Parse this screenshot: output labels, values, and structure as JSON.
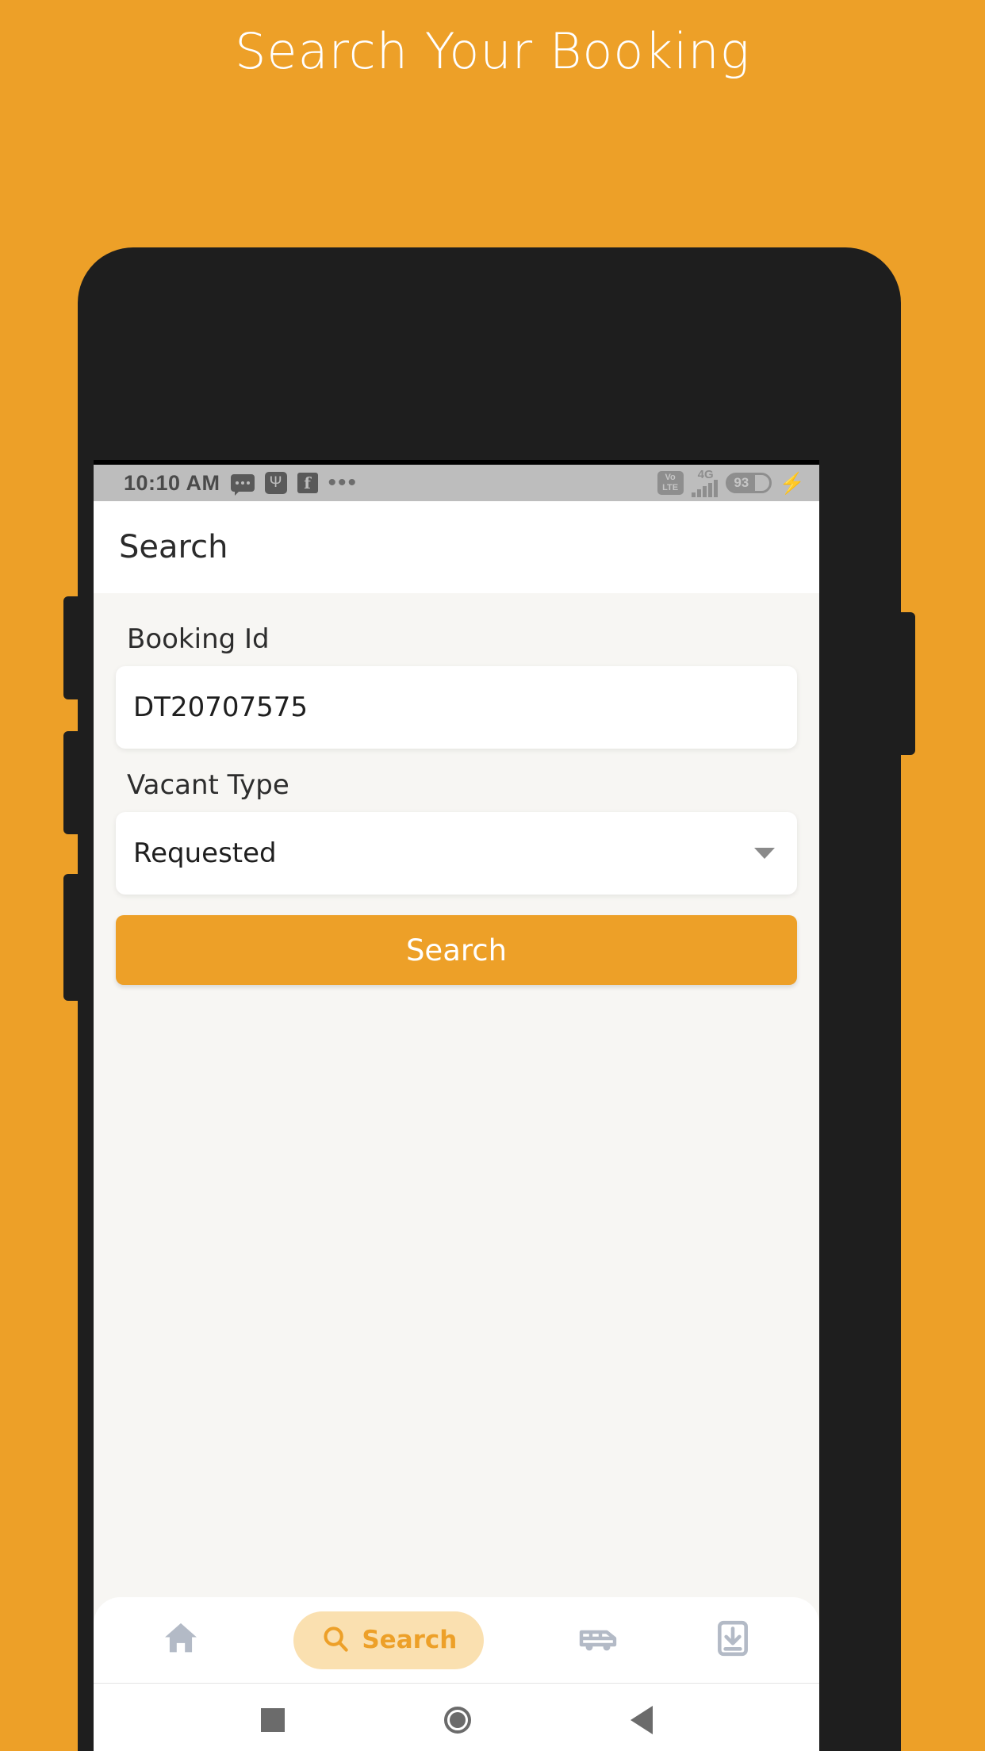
{
  "page": {
    "title": "Search Your Booking",
    "background_color": "#eda028",
    "accent_color": "#eda028"
  },
  "status_bar": {
    "time": "10:10 AM",
    "icons_left": [
      "message-icon",
      "usb-icon",
      "facebook-icon",
      "overflow-dots-icon"
    ],
    "usb_glyph": "Ψ",
    "facebook_glyph": "f",
    "dots_glyph": "•••",
    "volte_top": "Vo",
    "volte_bottom": "LTE",
    "network_type": "4G",
    "battery_level": "93",
    "charging_glyph": "⚡"
  },
  "app_bar": {
    "title": "Search"
  },
  "form": {
    "booking_id": {
      "label": "Booking Id",
      "value": "DT20707575",
      "placeholder": "Booking Id"
    },
    "vacant_type": {
      "label": "Vacant Type",
      "value": "Requested",
      "options": [
        "Requested"
      ]
    },
    "submit_label": "Search"
  },
  "bottom_nav": {
    "items": [
      {
        "name": "home",
        "label": "",
        "icon": "home-icon",
        "active": false
      },
      {
        "name": "search",
        "label": "Search",
        "icon": "search-icon",
        "active": true
      },
      {
        "name": "vehicle",
        "label": "",
        "icon": "van-icon",
        "active": false
      },
      {
        "name": "downloads",
        "label": "",
        "icon": "download-device-icon",
        "active": false
      }
    ]
  },
  "android_nav": {
    "recents": "recents-square",
    "home": "home-circle",
    "back": "back-triangle"
  }
}
